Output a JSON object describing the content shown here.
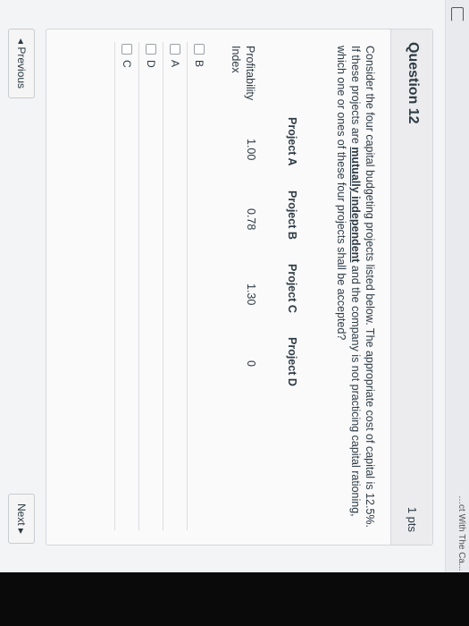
{
  "top_bar": {
    "breadcrumb": "…ct With The Ca... (C..."
  },
  "question": {
    "title": "Question 12",
    "points": "1 pts",
    "text_part1": "Consider the four capital budgeting projects listed below. The appropriate cost of capital is 12.5%. If these projects are ",
    "emphasis": "mutually independent",
    "text_part2": " and the company is not practicing capital rationing, which one or ones of these four projects shall be accepted?"
  },
  "table": {
    "headers": [
      "Project A",
      "Project B",
      "Project C",
      "Project D"
    ],
    "row_label_line1": "Profitability",
    "row_label_line2": "Index",
    "values": [
      "1.00",
      "0.78",
      "1.30",
      "0"
    ]
  },
  "answers": [
    {
      "label": "B"
    },
    {
      "label": "A"
    },
    {
      "label": "D"
    },
    {
      "label": "C"
    }
  ],
  "nav": {
    "previous": "◂ Previous",
    "next": "Next ▸"
  }
}
